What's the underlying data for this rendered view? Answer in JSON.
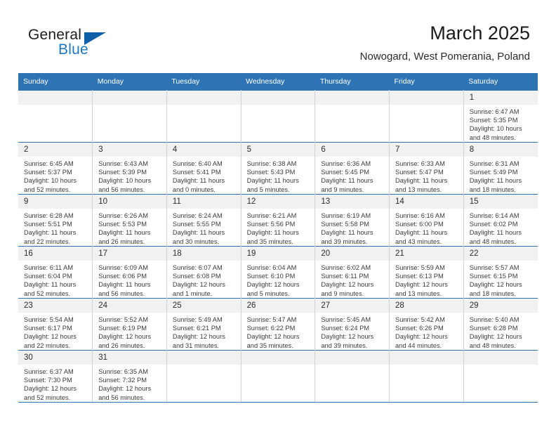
{
  "brand": {
    "name_part1": "General",
    "name_part2": "Blue",
    "flag_icon": "triangle-flag-icon",
    "accent_color": "#1b79c4",
    "flag_color": "#0f5ea8"
  },
  "header": {
    "month_title": "March 2025",
    "location": "Nowogard, West Pomerania, Poland",
    "header_bg_color": "#2e74b5",
    "daynum_bg_color": "#f1f1f1"
  },
  "weekdays": [
    "Sunday",
    "Monday",
    "Tuesday",
    "Wednesday",
    "Thursday",
    "Friday",
    "Saturday"
  ],
  "labels": {
    "sunrise_prefix": "Sunrise:",
    "sunset_prefix": "Sunset:",
    "daylight_prefix": "Daylight:"
  },
  "weeks": [
    [
      {
        "day": "",
        "blank": true
      },
      {
        "day": "",
        "blank": true
      },
      {
        "day": "",
        "blank": true
      },
      {
        "day": "",
        "blank": true
      },
      {
        "day": "",
        "blank": true
      },
      {
        "day": "",
        "blank": true
      },
      {
        "day": "1",
        "sunrise": "Sunrise: 6:47 AM",
        "sunset": "Sunset: 5:35 PM",
        "daylight1": "Daylight: 10 hours",
        "daylight2": "and 48 minutes."
      }
    ],
    [
      {
        "day": "2",
        "sunrise": "Sunrise: 6:45 AM",
        "sunset": "Sunset: 5:37 PM",
        "daylight1": "Daylight: 10 hours",
        "daylight2": "and 52 minutes."
      },
      {
        "day": "3",
        "sunrise": "Sunrise: 6:43 AM",
        "sunset": "Sunset: 5:39 PM",
        "daylight1": "Daylight: 10 hours",
        "daylight2": "and 56 minutes."
      },
      {
        "day": "4",
        "sunrise": "Sunrise: 6:40 AM",
        "sunset": "Sunset: 5:41 PM",
        "daylight1": "Daylight: 11 hours",
        "daylight2": "and 0 minutes."
      },
      {
        "day": "5",
        "sunrise": "Sunrise: 6:38 AM",
        "sunset": "Sunset: 5:43 PM",
        "daylight1": "Daylight: 11 hours",
        "daylight2": "and 5 minutes."
      },
      {
        "day": "6",
        "sunrise": "Sunrise: 6:36 AM",
        "sunset": "Sunset: 5:45 PM",
        "daylight1": "Daylight: 11 hours",
        "daylight2": "and 9 minutes."
      },
      {
        "day": "7",
        "sunrise": "Sunrise: 6:33 AM",
        "sunset": "Sunset: 5:47 PM",
        "daylight1": "Daylight: 11 hours",
        "daylight2": "and 13 minutes."
      },
      {
        "day": "8",
        "sunrise": "Sunrise: 6:31 AM",
        "sunset": "Sunset: 5:49 PM",
        "daylight1": "Daylight: 11 hours",
        "daylight2": "and 18 minutes."
      }
    ],
    [
      {
        "day": "9",
        "sunrise": "Sunrise: 6:28 AM",
        "sunset": "Sunset: 5:51 PM",
        "daylight1": "Daylight: 11 hours",
        "daylight2": "and 22 minutes."
      },
      {
        "day": "10",
        "sunrise": "Sunrise: 6:26 AM",
        "sunset": "Sunset: 5:53 PM",
        "daylight1": "Daylight: 11 hours",
        "daylight2": "and 26 minutes."
      },
      {
        "day": "11",
        "sunrise": "Sunrise: 6:24 AM",
        "sunset": "Sunset: 5:55 PM",
        "daylight1": "Daylight: 11 hours",
        "daylight2": "and 30 minutes."
      },
      {
        "day": "12",
        "sunrise": "Sunrise: 6:21 AM",
        "sunset": "Sunset: 5:56 PM",
        "daylight1": "Daylight: 11 hours",
        "daylight2": "and 35 minutes."
      },
      {
        "day": "13",
        "sunrise": "Sunrise: 6:19 AM",
        "sunset": "Sunset: 5:58 PM",
        "daylight1": "Daylight: 11 hours",
        "daylight2": "and 39 minutes."
      },
      {
        "day": "14",
        "sunrise": "Sunrise: 6:16 AM",
        "sunset": "Sunset: 6:00 PM",
        "daylight1": "Daylight: 11 hours",
        "daylight2": "and 43 minutes."
      },
      {
        "day": "15",
        "sunrise": "Sunrise: 6:14 AM",
        "sunset": "Sunset: 6:02 PM",
        "daylight1": "Daylight: 11 hours",
        "daylight2": "and 48 minutes."
      }
    ],
    [
      {
        "day": "16",
        "sunrise": "Sunrise: 6:11 AM",
        "sunset": "Sunset: 6:04 PM",
        "daylight1": "Daylight: 11 hours",
        "daylight2": "and 52 minutes."
      },
      {
        "day": "17",
        "sunrise": "Sunrise: 6:09 AM",
        "sunset": "Sunset: 6:06 PM",
        "daylight1": "Daylight: 11 hours",
        "daylight2": "and 56 minutes."
      },
      {
        "day": "18",
        "sunrise": "Sunrise: 6:07 AM",
        "sunset": "Sunset: 6:08 PM",
        "daylight1": "Daylight: 12 hours",
        "daylight2": "and 1 minute."
      },
      {
        "day": "19",
        "sunrise": "Sunrise: 6:04 AM",
        "sunset": "Sunset: 6:10 PM",
        "daylight1": "Daylight: 12 hours",
        "daylight2": "and 5 minutes."
      },
      {
        "day": "20",
        "sunrise": "Sunrise: 6:02 AM",
        "sunset": "Sunset: 6:11 PM",
        "daylight1": "Daylight: 12 hours",
        "daylight2": "and 9 minutes."
      },
      {
        "day": "21",
        "sunrise": "Sunrise: 5:59 AM",
        "sunset": "Sunset: 6:13 PM",
        "daylight1": "Daylight: 12 hours",
        "daylight2": "and 13 minutes."
      },
      {
        "day": "22",
        "sunrise": "Sunrise: 5:57 AM",
        "sunset": "Sunset: 6:15 PM",
        "daylight1": "Daylight: 12 hours",
        "daylight2": "and 18 minutes."
      }
    ],
    [
      {
        "day": "23",
        "sunrise": "Sunrise: 5:54 AM",
        "sunset": "Sunset: 6:17 PM",
        "daylight1": "Daylight: 12 hours",
        "daylight2": "and 22 minutes."
      },
      {
        "day": "24",
        "sunrise": "Sunrise: 5:52 AM",
        "sunset": "Sunset: 6:19 PM",
        "daylight1": "Daylight: 12 hours",
        "daylight2": "and 26 minutes."
      },
      {
        "day": "25",
        "sunrise": "Sunrise: 5:49 AM",
        "sunset": "Sunset: 6:21 PM",
        "daylight1": "Daylight: 12 hours",
        "daylight2": "and 31 minutes."
      },
      {
        "day": "26",
        "sunrise": "Sunrise: 5:47 AM",
        "sunset": "Sunset: 6:22 PM",
        "daylight1": "Daylight: 12 hours",
        "daylight2": "and 35 minutes."
      },
      {
        "day": "27",
        "sunrise": "Sunrise: 5:45 AM",
        "sunset": "Sunset: 6:24 PM",
        "daylight1": "Daylight: 12 hours",
        "daylight2": "and 39 minutes."
      },
      {
        "day": "28",
        "sunrise": "Sunrise: 5:42 AM",
        "sunset": "Sunset: 6:26 PM",
        "daylight1": "Daylight: 12 hours",
        "daylight2": "and 44 minutes."
      },
      {
        "day": "29",
        "sunrise": "Sunrise: 5:40 AM",
        "sunset": "Sunset: 6:28 PM",
        "daylight1": "Daylight: 12 hours",
        "daylight2": "and 48 minutes."
      }
    ],
    [
      {
        "day": "30",
        "sunrise": "Sunrise: 6:37 AM",
        "sunset": "Sunset: 7:30 PM",
        "daylight1": "Daylight: 12 hours",
        "daylight2": "and 52 minutes."
      },
      {
        "day": "31",
        "sunrise": "Sunrise: 6:35 AM",
        "sunset": "Sunset: 7:32 PM",
        "daylight1": "Daylight: 12 hours",
        "daylight2": "and 56 minutes."
      },
      {
        "day": "",
        "blank": true
      },
      {
        "day": "",
        "blank": true
      },
      {
        "day": "",
        "blank": true
      },
      {
        "day": "",
        "blank": true
      },
      {
        "day": "",
        "blank": true
      }
    ]
  ]
}
